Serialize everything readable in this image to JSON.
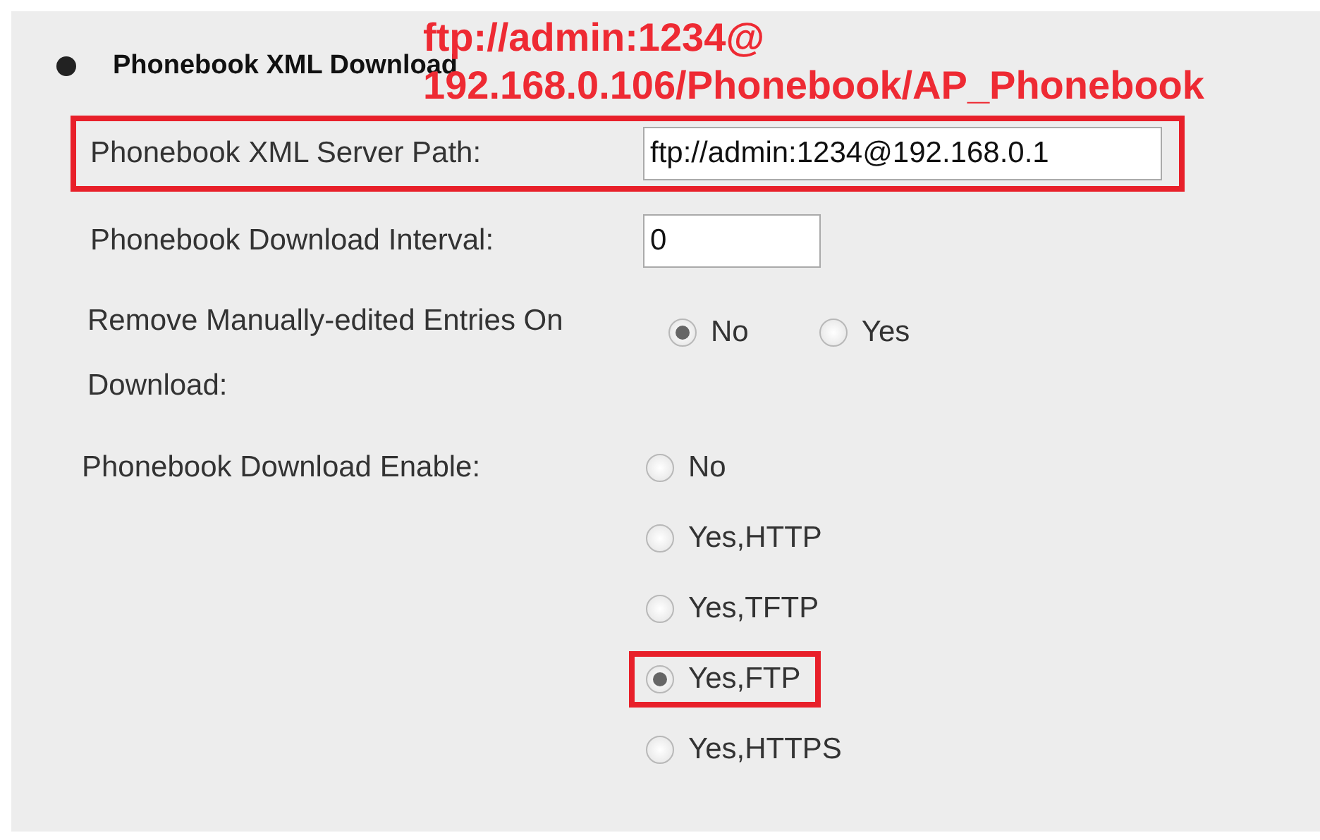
{
  "section": {
    "title": "Phonebook XML Download"
  },
  "annotation": {
    "lines": [
      "ftp://admin:1234@",
      "192.168.0.106/Phonebook/AP_Phonebook"
    ]
  },
  "fields": [
    {
      "kind": "text",
      "label": "Phonebook XML Server Path:",
      "value": "ftp://admin:1234@192.168.0.1",
      "highlighted": true
    },
    {
      "kind": "text",
      "label": "Phonebook Download Interval:",
      "value": "0",
      "highlighted": false
    },
    {
      "kind": "inline-radio",
      "label_lines": [
        "Remove Manually-edited Entries On",
        "Download:"
      ],
      "options": [
        {
          "label": "No",
          "selected": true,
          "highlighted": false
        },
        {
          "label": "Yes",
          "selected": false,
          "highlighted": false
        }
      ]
    },
    {
      "kind": "stacked-radio",
      "label": "Phonebook Download Enable:",
      "options": [
        {
          "label": "No",
          "selected": false,
          "highlighted": false
        },
        {
          "label": "Yes,HTTP",
          "selected": false,
          "highlighted": false
        },
        {
          "label": "Yes,TFTP",
          "selected": false,
          "highlighted": false
        },
        {
          "label": "Yes,FTP",
          "selected": true,
          "highlighted": true
        },
        {
          "label": "Yes,HTTPS",
          "selected": false,
          "highlighted": false
        }
      ]
    }
  ]
}
